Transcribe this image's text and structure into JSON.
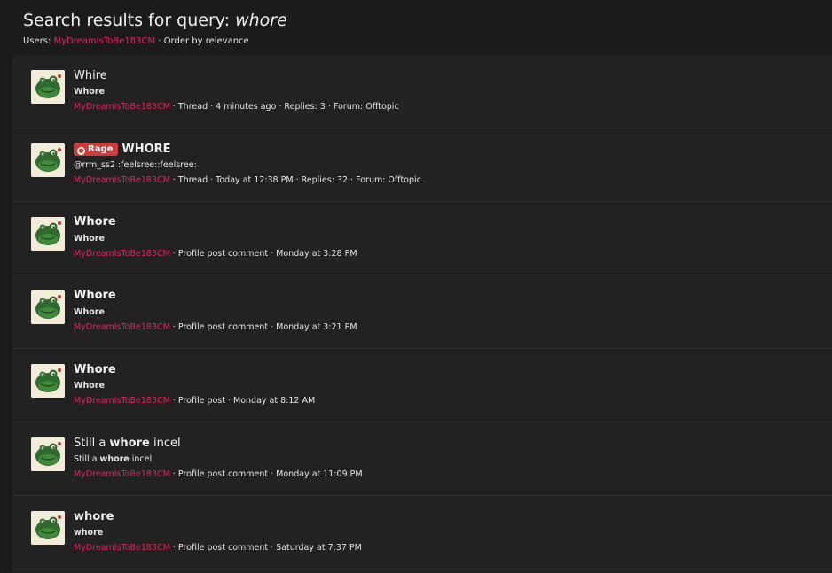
{
  "header": {
    "title_prefix": "Search results for query: ",
    "query": "whore",
    "users_label": "Users: ",
    "user": "MyDreamIsToBe183CM",
    "order": " · Order by relevance"
  },
  "colors": {
    "accent": "#e0245e",
    "badge": "#d33a3a",
    "panel": "#222222",
    "background": "#1b1b1b"
  },
  "results": [
    {
      "title": "Whire",
      "snippet": "Whore",
      "author": "MyDreamIsToBe183CM",
      "meta": " · Thread · 4 minutes ago · Replies: 3 · Forum: Offtopic"
    },
    {
      "badge": "Rage",
      "badge_icon": "angry-face-icon",
      "title": "WHORE",
      "snippet": "@rrm_ss2 :feelsree::feelsree:",
      "author": "MyDreamIsToBe183CM",
      "meta": " · Thread · Today at 12:38 PM · Replies: 32 · Forum: Offtopic"
    },
    {
      "title": "Whore",
      "snippet": "Whore",
      "author": "MyDreamIsToBe183CM",
      "meta": " · Profile post comment · Monday at 3:28 PM"
    },
    {
      "title": "Whore",
      "snippet": "Whore",
      "author": "MyDreamIsToBe183CM",
      "meta": " · Profile post comment · Monday at 3:21 PM"
    },
    {
      "title": "Whore",
      "snippet": "Whore",
      "author": "MyDreamIsToBe183CM",
      "meta": " · Profile post · Monday at 8:12 AM"
    },
    {
      "title_pre": "Still a ",
      "title_match": "whore",
      "title_post": " incel",
      "snippet_pre": "Still a ",
      "snippet_match": "whore",
      "snippet_post": " incel",
      "author": "MyDreamIsToBe183CM",
      "meta": " · Profile post comment · Monday at 11:09 PM"
    },
    {
      "title": "whore",
      "snippet": "whore",
      "author": "MyDreamIsToBe183CM",
      "meta": " · Profile post comment · Saturday at 7:37 PM"
    }
  ],
  "avatar_icon": "green-frog-avatar-icon"
}
